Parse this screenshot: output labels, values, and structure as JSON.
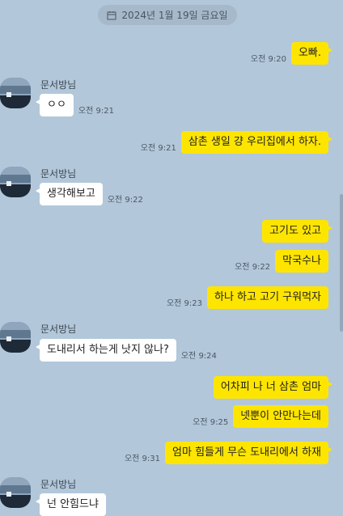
{
  "date_label": "2024년 1월 19일 금요일",
  "sender_name": "문서방님",
  "messages": [
    {
      "from": "me",
      "text": "오빠.",
      "time": "오전 9:20"
    },
    {
      "from": "them",
      "text": "ㅇㅇ",
      "time": "오전 9:21"
    },
    {
      "from": "me",
      "text": "삼촌 생일 걍 우리집에서 하자.",
      "time": "오전 9:21"
    },
    {
      "from": "them",
      "text": "생각해보고",
      "time": "오전 9:22"
    },
    {
      "from": "me",
      "text": "고기도 있고",
      "time": ""
    },
    {
      "from": "me",
      "text": "막국수나",
      "time": "오전 9:22"
    },
    {
      "from": "me",
      "text": "하나 하고 고기 구워먹자",
      "time": "오전 9:23"
    },
    {
      "from": "them",
      "text": "도내리서 하는게 낫지 않나?",
      "time": "오전 9:24"
    },
    {
      "from": "me",
      "text": "어차피 나 너 삼촌 엄마",
      "time": ""
    },
    {
      "from": "me",
      "text": "넷뿐이 안만나는데",
      "time": "오전 9:25"
    },
    {
      "from": "me",
      "text": "엄마 힘들게 무슨 도내리에서 하재",
      "time": "오전 9:31"
    },
    {
      "from": "them",
      "text": "넌 안힘드냐",
      "time": ""
    }
  ]
}
